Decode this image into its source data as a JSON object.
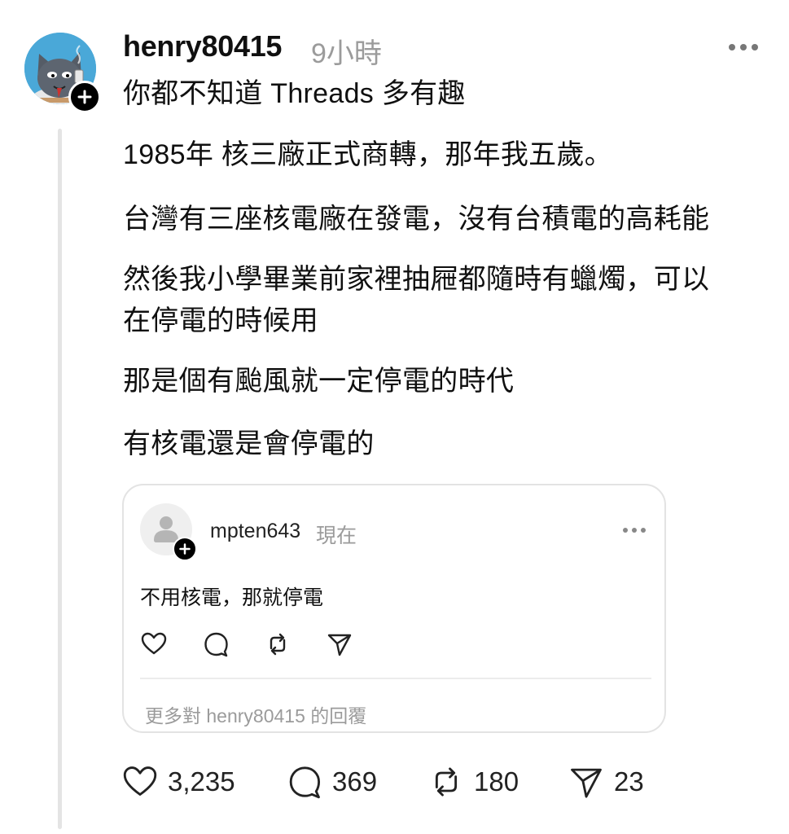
{
  "post": {
    "author": "henry80415",
    "time": "9小時",
    "lines": [
      "你都不知道 Threads 多有趣",
      "1985年 核三廠正式商轉，那年我五歲。",
      "台灣有三座核電廠在發電，沒有台積電的高耗能",
      "然後我小學畢業前家裡抽屜都隨時有蠟燭，可以",
      "在停電的時候用",
      "那是個有颱風就一定停電的時代",
      "有核電還是會停電的"
    ],
    "stats": {
      "likes": "3,235",
      "replies": "369",
      "reposts": "180",
      "shares": "23"
    }
  },
  "quote": {
    "author": "mpten643",
    "time": "現在",
    "text": "不用核電，那就停電",
    "more_replies": "更多對 henry80415 的回覆"
  },
  "icons": {
    "like": "heart-icon",
    "reply": "speech-bubble-icon",
    "repost": "repost-arrows-icon",
    "share": "paper-plane-icon",
    "more": "ellipsis-icon",
    "follow": "plus-icon"
  },
  "colors": {
    "text": "#101010",
    "muted": "#9b9b9b",
    "line": "#e4e4e4",
    "avatar_bg": "#4aa8d8"
  }
}
